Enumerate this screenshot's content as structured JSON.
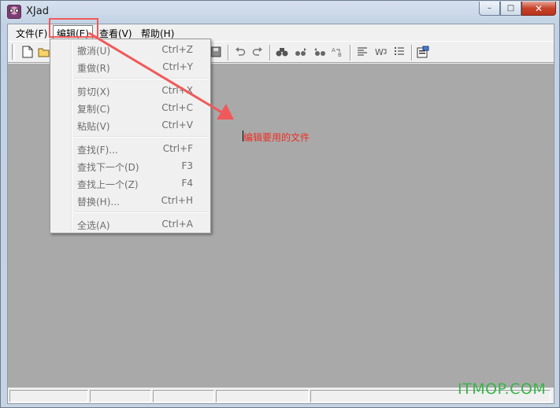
{
  "window": {
    "title": "XJad",
    "controls": {
      "minimize": "–",
      "maximize": "□",
      "close": "✕"
    }
  },
  "menubar": [
    "文件(F)",
    "编辑(E)",
    "查看(V)",
    "帮助(H)"
  ],
  "edit_menu": [
    {
      "label": "撤消(U)",
      "shortcut": "Ctrl+Z"
    },
    {
      "label": "重做(R)",
      "shortcut": "Ctrl+Y"
    },
    {
      "label": "剪切(X)",
      "shortcut": "Ctrl+X"
    },
    {
      "label": "复制(C)",
      "shortcut": "Ctrl+C"
    },
    {
      "label": "粘贴(V)",
      "shortcut": "Ctrl+V"
    },
    {
      "label": "查找(F)...",
      "shortcut": "Ctrl+F"
    },
    {
      "label": "查找下一个(D)",
      "shortcut": "F3"
    },
    {
      "label": "查找上一个(Z)",
      "shortcut": "F4"
    },
    {
      "label": "替换(H)...",
      "shortcut": "Ctrl+H"
    },
    {
      "label": "全选(A)",
      "shortcut": "Ctrl+A"
    }
  ],
  "toolbar_icons": [
    "new-file-icon",
    "open-folder-icon",
    "save-icon",
    "undo-icon",
    "redo-icon",
    "find-icon",
    "find-next-icon",
    "find-previous-icon",
    "replace-icon",
    "align-left-icon",
    "word-wrap-icon",
    "list-icon",
    "properties-icon"
  ],
  "annotation": {
    "text": "编辑要用的文件",
    "color": "#ee2d24",
    "highlight_color": "#f0595a"
  },
  "watermark": {
    "text": "ITMOP.COM",
    "color": "#39b54a"
  }
}
